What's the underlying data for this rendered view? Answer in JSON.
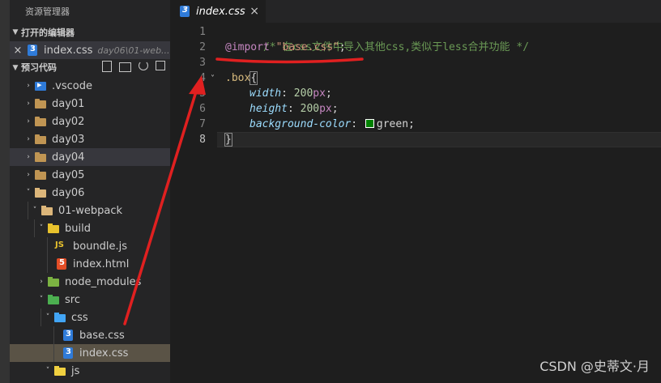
{
  "sidebar": {
    "title": "资源管理器",
    "open_editors": {
      "header": "打开的编辑器",
      "items": [
        {
          "name": "index.css",
          "description": "day06\\01-web..."
        }
      ]
    },
    "workspace": {
      "header": "预习代码",
      "tree": [
        {
          "label": ".vscode",
          "icon": "vscode-folder-icon"
        },
        {
          "label": "day01",
          "icon": "folder-icon"
        },
        {
          "label": "day02",
          "icon": "folder-icon"
        },
        {
          "label": "day03",
          "icon": "folder-icon"
        },
        {
          "label": "day04",
          "icon": "folder-icon"
        },
        {
          "label": "day05",
          "icon": "folder-icon"
        },
        {
          "label": "day06",
          "icon": "folder-open-icon"
        },
        {
          "label": "01-webpack",
          "icon": "folder-open-icon"
        },
        {
          "label": "build",
          "icon": "build-folder-icon"
        },
        {
          "label": "boundle.js",
          "icon": "js-file-icon"
        },
        {
          "label": "index.html",
          "icon": "html-file-icon"
        },
        {
          "label": "node_modules",
          "icon": "node-modules-folder-icon"
        },
        {
          "label": "src",
          "icon": "src-folder-icon"
        },
        {
          "label": "css",
          "icon": "css-folder-icon"
        },
        {
          "label": "base.css",
          "icon": "css-file-icon"
        },
        {
          "label": "index.css",
          "icon": "css-file-icon"
        },
        {
          "label": "js",
          "icon": "js-folder-icon"
        }
      ]
    }
  },
  "editor": {
    "tab": {
      "label": "index.css"
    },
    "line_numbers": [
      "1",
      "2",
      "3",
      "4",
      "5",
      "6",
      "7",
      "8"
    ],
    "code": {
      "line1_comment": "/* 在css文件中导入其他css,类似于less合并功能 */",
      "line2_at": "@import",
      "line2_str": "\"base.css\"",
      "line2_semi": ";",
      "line4_selector": ".box",
      "line4_brace": "{",
      "line5_prop": "width",
      "line5_num": "200",
      "line5_unit": "px",
      "line6_prop": "height",
      "line6_num": "200",
      "line6_unit": "px",
      "line7_prop": "background-color",
      "line7_value": "green",
      "line8_brace": "}",
      "colon": ":",
      "semi": ";"
    },
    "colors": {
      "comment": "#6a9955",
      "keyword": "#c586c0",
      "string": "#ce9178",
      "selector": "#d7ba7d",
      "property": "#9cdcfe",
      "number": "#b5cea8",
      "annotation": "#e02020",
      "swatch": "#008000"
    }
  },
  "watermark": "CSDN @史蒂文·月"
}
